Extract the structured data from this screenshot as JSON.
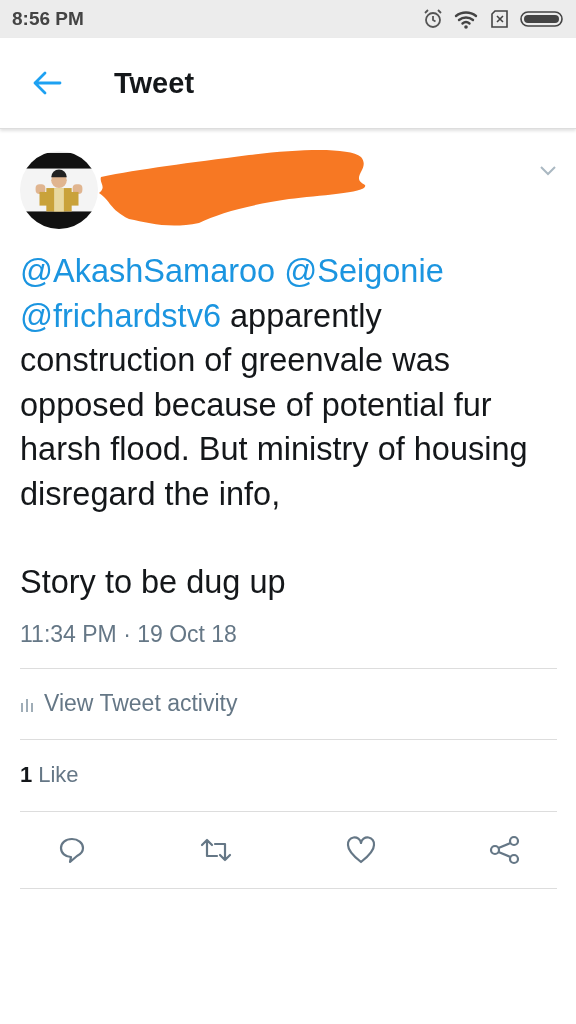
{
  "status_bar": {
    "time": "8:56 PM"
  },
  "header": {
    "title": "Tweet"
  },
  "tweet": {
    "avatar": {
      "kind": "picture"
    },
    "paragraphs": [
      [
        {
          "kind": "mention",
          "text": "@AkashSamaroo"
        },
        {
          "kind": "mention",
          "text": "@Seigonie"
        },
        {
          "kind": "mention",
          "text": "@frichardstv6"
        },
        {
          "kind": "text",
          "text": " apparently construction of greenvale was opposed because of potential fur harsh flood. But ministry of housing disregard the info,"
        }
      ],
      [
        {
          "kind": "text",
          "text": "Story to be dug up"
        }
      ]
    ],
    "timestamp": "11:34 PM · 19 Oct 18",
    "activity_link": "View Tweet activity",
    "likes": {
      "count": "1",
      "label": "Like"
    }
  }
}
